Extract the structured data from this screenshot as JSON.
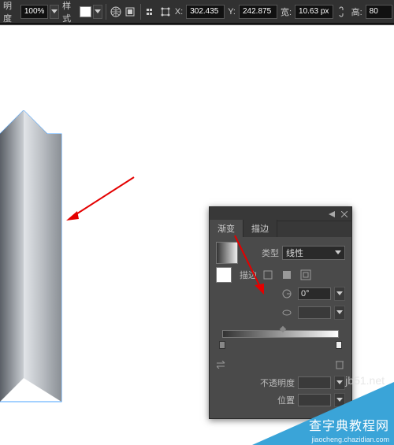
{
  "toolbar": {
    "opacity_label": "明度",
    "opacity_value": "100%",
    "style_label": "样式",
    "x_label": "X:",
    "x_value": "302.435",
    "y_label": "Y:",
    "y_value": "242.875",
    "w_label": "宽:",
    "w_value": "10.63 px",
    "h_label": "高:",
    "h_value": "80"
  },
  "gradient_panel": {
    "tab_gradient": "渐变",
    "tab_stroke": "描边",
    "type_label": "类型",
    "type_value": "线性",
    "stroke_label": "描边",
    "angle_value": "0°",
    "opacity_label": "不透明度",
    "position_label": "位置"
  },
  "watermark": {
    "site": "jb51.net",
    "brand": "查字典教程网",
    "url": "jiaocheng.chazidian.com"
  }
}
